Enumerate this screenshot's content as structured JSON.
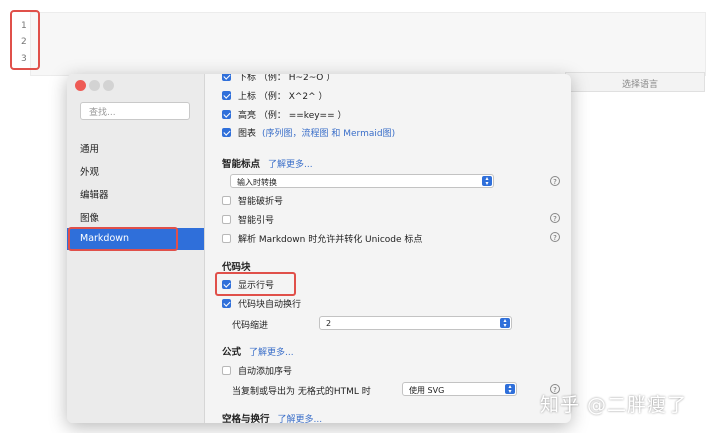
{
  "editor": {
    "line_numbers": [
      "1",
      "2",
      "3"
    ],
    "language_placeholder": "选择语言"
  },
  "sidebar": {
    "search_placeholder": "查找...",
    "items": [
      {
        "label": "通用"
      },
      {
        "label": "外观"
      },
      {
        "label": "编辑器"
      },
      {
        "label": "图像"
      },
      {
        "label": "Markdown",
        "selected": true
      }
    ]
  },
  "content": {
    "syntax_rows": [
      {
        "label": "下标 （例： H~2~O ）",
        "checked": true
      },
      {
        "label": "上标 （例： X^2^ ）",
        "checked": true
      },
      {
        "label": "高亮 （例： ==key== ）",
        "checked": true
      },
      {
        "label": "图表",
        "note": "(序列图，流程图 和 Mermaid图)",
        "checked": true
      }
    ],
    "smart_punct": {
      "title": "智能标点",
      "learn_more": "了解更多...",
      "select_value": "输入时转换",
      "options": [
        {
          "label": "智能破折号",
          "checked": false
        },
        {
          "label": "智能引号",
          "checked": false
        },
        {
          "label": "解析 Markdown 时允许并转化 Unicode 标点",
          "checked": false
        }
      ]
    },
    "code_block": {
      "title": "代码块",
      "options": [
        {
          "label": "显示行号",
          "checked": true
        },
        {
          "label": "代码块自动换行",
          "checked": true
        }
      ],
      "indent_label": "代码缩进",
      "indent_value": "2"
    },
    "math": {
      "title": "公式",
      "learn_more": "了解更多...",
      "auto_number_label": "自动添加序号",
      "auto_number_checked": false,
      "export_label": "当复制或导出为 无格式的HTML 时",
      "export_value": "使用 SVG"
    },
    "whitespace": {
      "title": "空格与换行",
      "learn_more": "了解更多..."
    }
  },
  "watermark": "知乎 @二胖瘦了",
  "colors": {
    "accent": "#2f6fda",
    "highlight_box": "#e0504a",
    "link": "#3b6fc9"
  }
}
